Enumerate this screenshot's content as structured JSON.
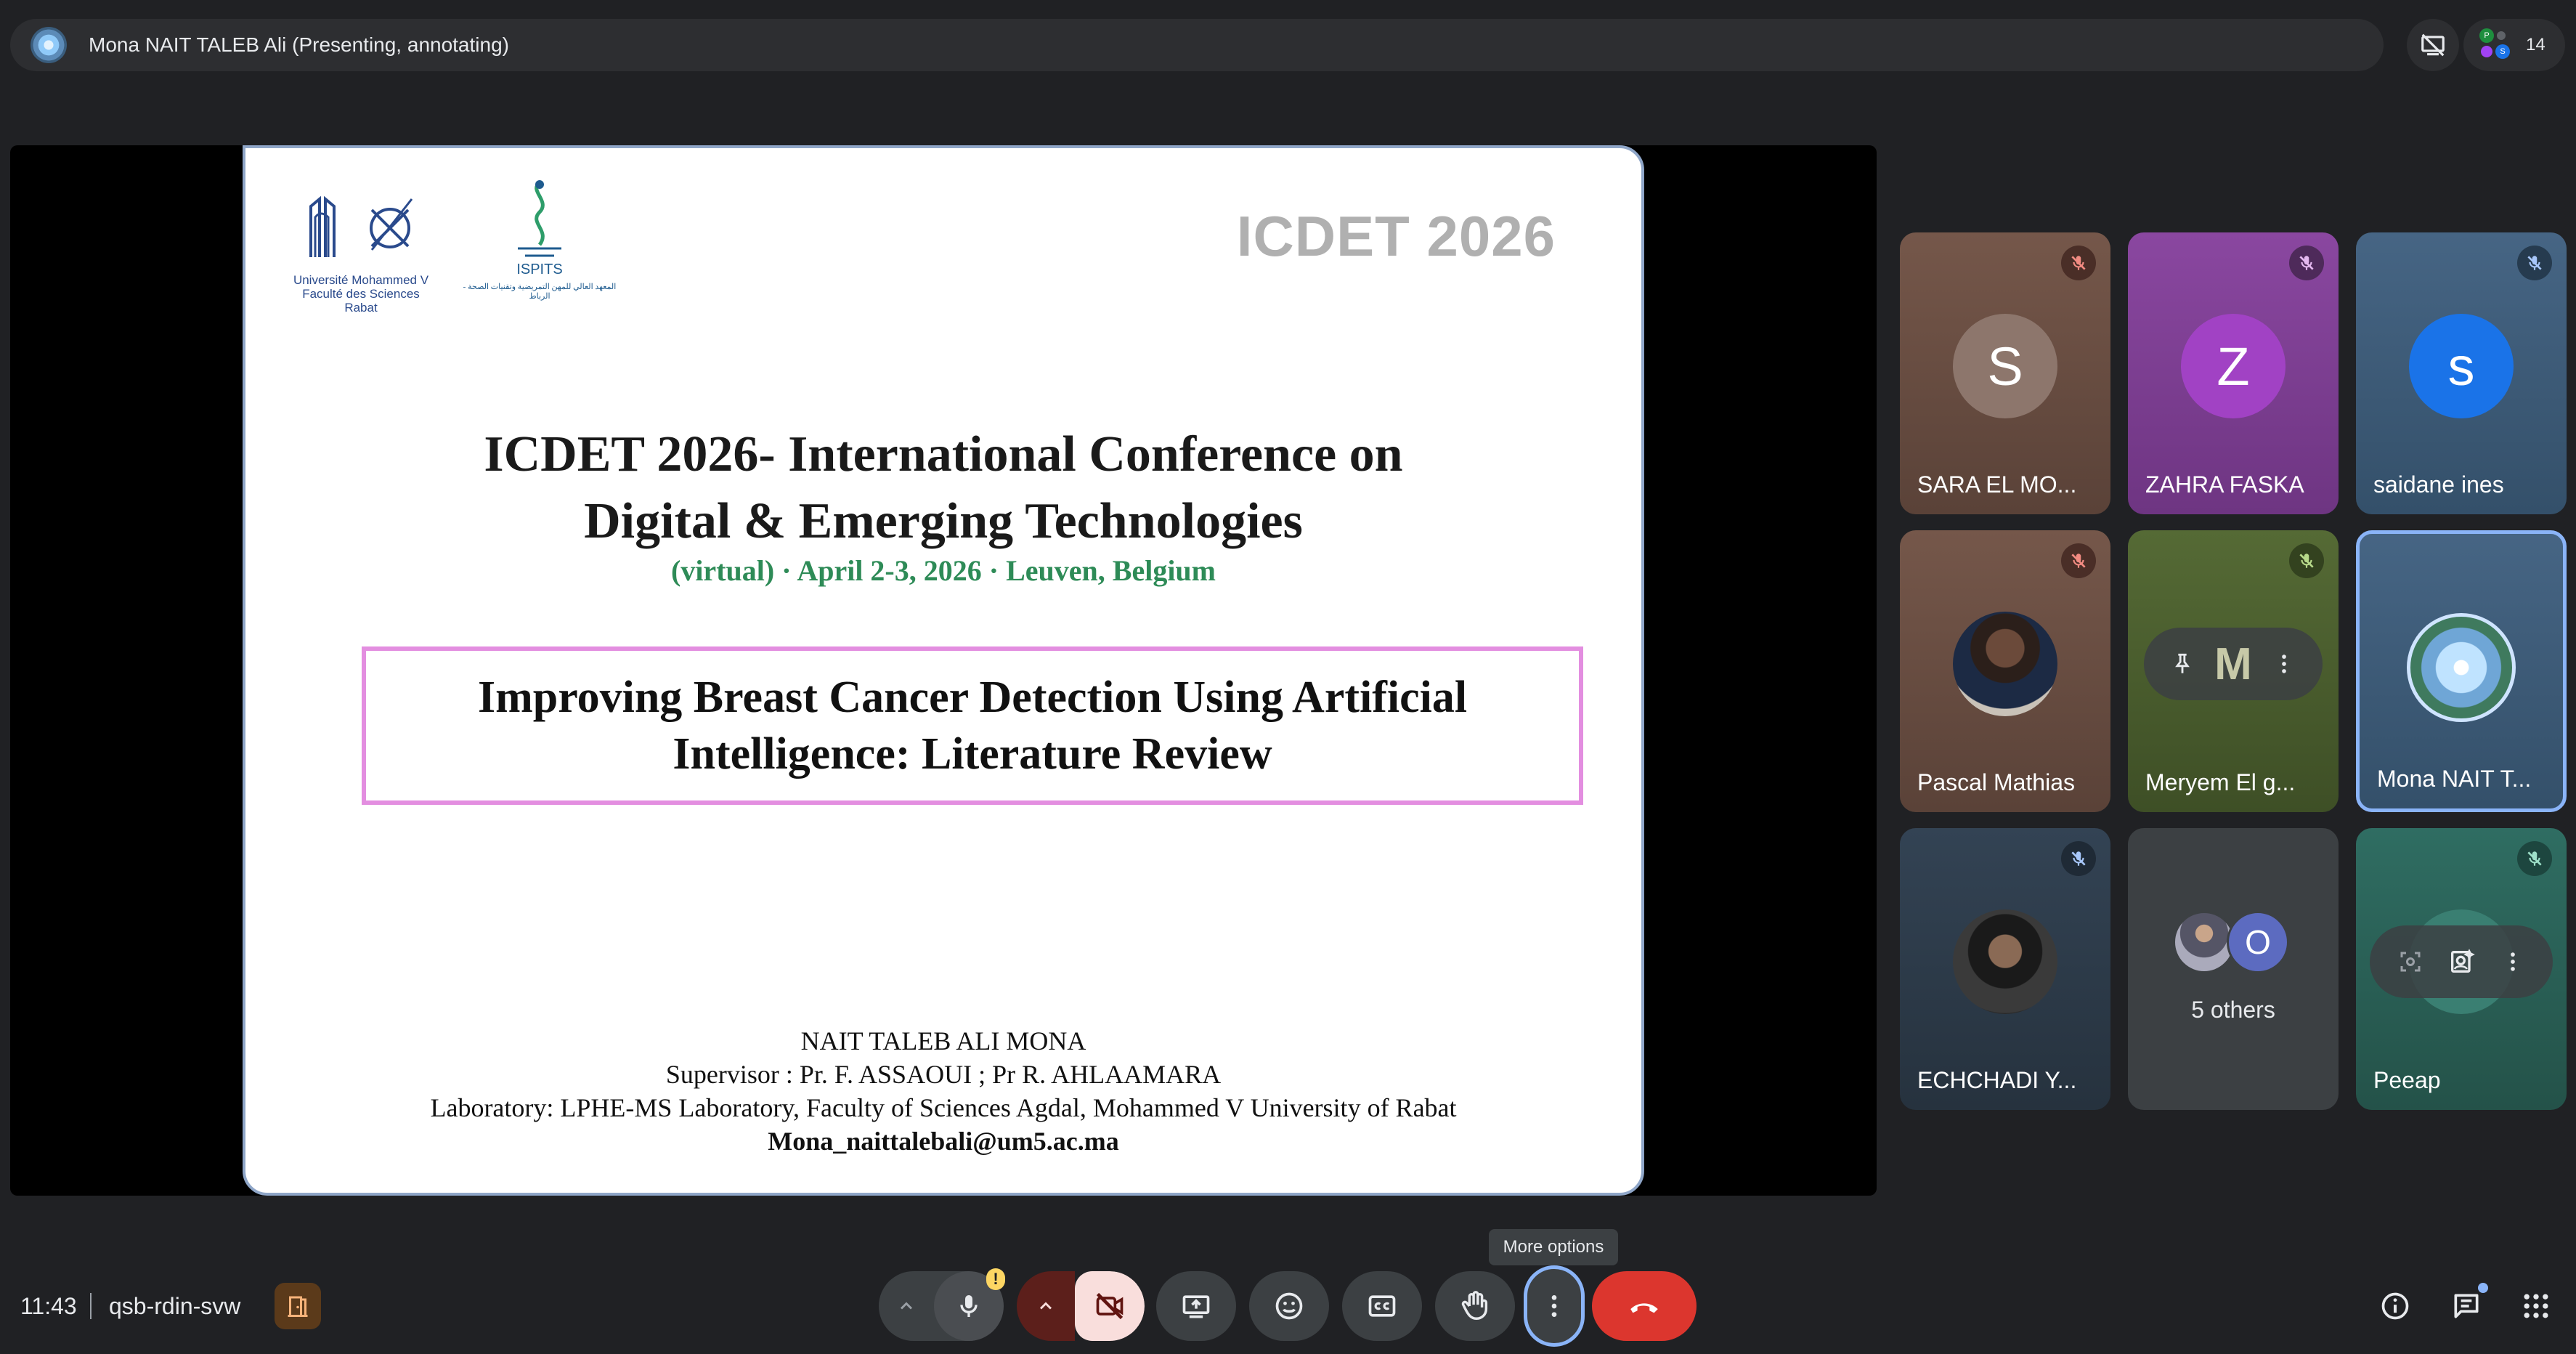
{
  "presenter_bar": {
    "text": "Mona NAIT TALEB Ali (Presenting, annotating)"
  },
  "top_right": {
    "participant_count": "14",
    "mini_avatars": [
      "P",
      "",
      "S"
    ]
  },
  "slide": {
    "logo1_text": "Université Mohammed V\nFaculté des Sciences\nRabat",
    "logo2_text": "ISPITS",
    "logo2_arabic": "المعهد العالي للمهن التمريضية وتقنيات الصحة - الرباط",
    "watermark": "ICDET 2026",
    "title_line1": "ICDET 2026- International Conference on",
    "title_line2": "Digital & Emerging Technologies",
    "subtitle": "(virtual) · April 2-3, 2026 · Leuven, Belgium",
    "talk_title_line1": "Improving Breast Cancer Detection Using Artificial",
    "talk_title_line2": "Intelligence: Literature Review",
    "author": "NAIT TALEB ALI MONA",
    "supervisor": "Supervisor : Pr. F. ASSAOUI ; Pr R. AHLAAMARA",
    "laboratory": "Laboratory: LPHE-MS Laboratory, Faculty of Sciences Agdal, Mohammed V University of Rabat",
    "email": "Mona_naittalebali@um5.ac.ma"
  },
  "participants": [
    {
      "name": "SARA EL MO...",
      "initial": "S",
      "color": "#6b4e43"
    },
    {
      "name": "ZAHRA FASKA",
      "initial": "Z",
      "color": "#7a3f8f"
    },
    {
      "name": "saidane ines",
      "initial": "s",
      "color": "#3d5670"
    },
    {
      "name": "Pascal Mathias",
      "initial": "",
      "color": "#6b4e43"
    },
    {
      "name": "Meryem El g...",
      "initial": "M",
      "color": "#4a5a2e"
    },
    {
      "name": "Mona NAIT T...",
      "initial": "",
      "color": "#3d5670"
    },
    {
      "name": "ECHCHADI Y...",
      "initial": "",
      "color": "#2f3d4c"
    },
    {
      "name": "5 others",
      "initial": "O",
      "color": "#3c4043"
    },
    {
      "name": "Peeap",
      "initial": "",
      "color": "#2f5d55"
    }
  ],
  "tooltip": "More options",
  "bottom": {
    "time": "11:43",
    "meeting_code": "qsb-rdin-svw",
    "mic_warning": "!"
  },
  "colors": {
    "bg": "#202124",
    "control": "#3c4043",
    "end_call": "#dc362e",
    "accent": "#8ab4f8",
    "cam_off": "#f9dedc",
    "cam_off_arrow": "#5c1f1b"
  }
}
